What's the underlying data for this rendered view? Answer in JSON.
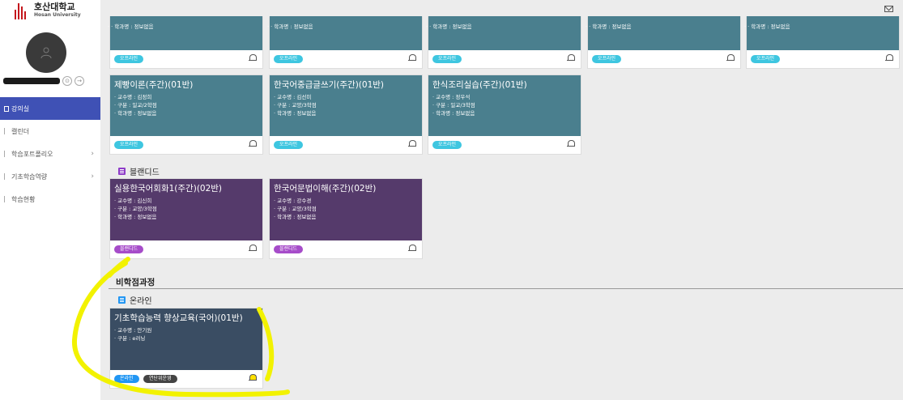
{
  "logo": {
    "kor": "호산대학교",
    "eng": "Hosan University"
  },
  "sidebar": {
    "items": [
      {
        "label": "강의실",
        "active": true
      },
      {
        "label": "캘린더"
      },
      {
        "label": "학습포트폴리오",
        "chevron": "›"
      },
      {
        "label": "기초학습역량",
        "chevron": "›"
      },
      {
        "label": "학습현황"
      }
    ]
  },
  "row0": {
    "line": "· 학과명 : 정보없음",
    "badge": "오프라인"
  },
  "offline_cards": [
    {
      "title": "제빵이론(주간)(01반)",
      "prof": "교수명 : 김정희",
      "type": "구분 : 일교/2학점",
      "dept": "학과명 : 정보없음",
      "badge": "오프라인"
    },
    {
      "title": "한국어중급글쓰기(주간)(01반)",
      "prof": "교수명 : 김선미",
      "type": "구분 : 교양/3학점",
      "dept": "학과명 : 정보없음",
      "badge": "오프라인"
    },
    {
      "title": "한식조리실습(주간)(01반)",
      "prof": "교수명 : 정우석",
      "type": "구분 : 일교/3학점",
      "dept": "학과명 : 정보없음",
      "badge": "오프라인"
    }
  ],
  "blended": {
    "heading": "블랜디드",
    "cards": [
      {
        "title": "실용한국어회화1(주간)(02반)",
        "prof": "교수명 : 김신희",
        "type": "구분 : 교양/3학점",
        "dept": "학과명 : 정보없음",
        "badge": "블랜디드"
      },
      {
        "title": "한국어문법이해(주간)(02반)",
        "prof": "교수명 : 강수경",
        "type": "구분 : 교양/3학점",
        "dept": "학과명 : 정보없음",
        "badge": "블랜디드"
      }
    ]
  },
  "noncredit": {
    "heading": "비학점과정",
    "sub_heading": "온라인",
    "card": {
      "title": "기초학습능력 향상교육(국어)(01반)",
      "prof": "교수명 : 안기원",
      "type": "구분 : e러닝",
      "badge1": "온라인",
      "badge2": "연단위운영"
    }
  },
  "colors": {
    "teal": "#4a7f8e",
    "purple": "#553a6b",
    "navy": "#3a4d63",
    "accent": "#3f51b5",
    "highlight": "#f2f200"
  }
}
